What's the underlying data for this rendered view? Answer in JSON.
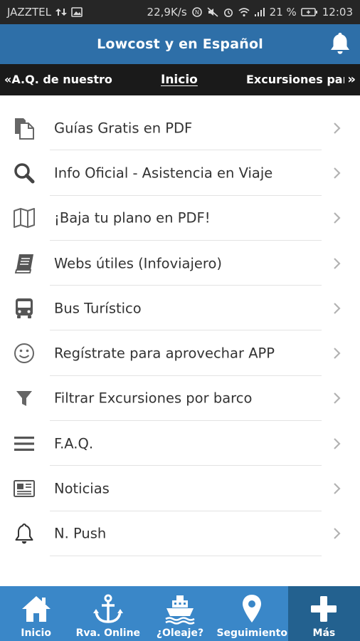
{
  "status_bar": {
    "carrier": "JAZZTEL",
    "speed": "22,9K/s",
    "battery": "21 %",
    "time": "12:03"
  },
  "header": {
    "title": "Lowcost y en Español",
    "bell_icon": "bell-icon"
  },
  "tabs": {
    "prev_arrow": "«",
    "prev": "A.Q. de nuestro",
    "active": "Inicio",
    "next": "Excursiones para",
    "next_arrow": "»"
  },
  "menu": {
    "items": [
      {
        "label": "Guías Gratis en PDF",
        "icon": "documents-icon"
      },
      {
        "label": "Info Oficial - Asistencia en Viaje",
        "icon": "search-icon"
      },
      {
        "label": "¡Baja tu plano en PDF!",
        "icon": "map-icon"
      },
      {
        "label": "Webs útiles (Infoviajero)",
        "icon": "book-icon"
      },
      {
        "label": "Bus Turístico",
        "icon": "bus-icon"
      },
      {
        "label": "Regístrate para aprovechar APP",
        "icon": "smiley-icon"
      },
      {
        "label": "Filtrar Excursiones por barco",
        "icon": "filter-icon"
      },
      {
        "label": "F.A.Q.",
        "icon": "menu-lines-icon"
      },
      {
        "label": "Noticias",
        "icon": "newspaper-icon"
      },
      {
        "label": "N. Push",
        "icon": "bell-outline-icon"
      }
    ]
  },
  "bottom_nav": {
    "items": [
      {
        "label": "Inicio",
        "icon": "home-icon"
      },
      {
        "label": "Rva. Online",
        "icon": "anchor-icon"
      },
      {
        "label": "¿Oleaje?",
        "icon": "ship-icon"
      },
      {
        "label": "Seguimiento",
        "icon": "map-pin-icon"
      },
      {
        "label": "Más",
        "icon": "plus-icon"
      }
    ],
    "active_index": 4
  },
  "colors": {
    "header_bg": "#2e6fa8",
    "tabs_bg": "#1a1a1a",
    "bottom_nav_bg": "#3a87c8",
    "bottom_nav_active": "#23618f"
  }
}
